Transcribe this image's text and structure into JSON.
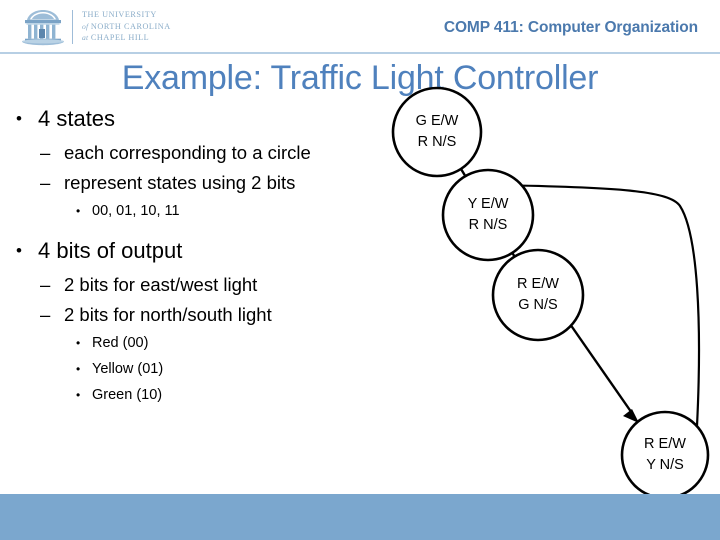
{
  "header": {
    "logo": {
      "mark_name": "unc-old-well-logo",
      "line1": "THE UNIVERSITY",
      "line2_prefix": "of",
      "line2": "NORTH CAROLINA",
      "line3_prefix": "at",
      "line3": "CHAPEL HILL"
    },
    "course_title": "COMP 411: Computer Organization"
  },
  "slide": {
    "title": "Example: Traffic Light Controller"
  },
  "bullets": {
    "group1": {
      "level1": "4 states",
      "level2_a": "each corresponding to a circle",
      "level2_b": "represent states using 2 bits",
      "level3_a": "00, 01, 10, 11"
    },
    "group2": {
      "level1": "4 bits of output",
      "level2_a": "2 bits for east/west light",
      "level2_b": "2 bits for north/south light",
      "level3_a": "Red (00)",
      "level3_b": "Yellow (01)",
      "level3_c": "Green (10)"
    }
  },
  "diagram": {
    "states": [
      {
        "id": "state-1",
        "line1": "G E/W",
        "line2": "R N/S"
      },
      {
        "id": "state-2",
        "line1": "Y E/W",
        "line2": "R N/S"
      },
      {
        "id": "state-3",
        "line1": "R E/W",
        "line2": "G N/S"
      },
      {
        "id": "state-4",
        "line1": "R E/W",
        "line2": "Y N/S"
      }
    ],
    "transitions": [
      {
        "from": "state-1",
        "to": "state-2"
      },
      {
        "from": "state-2",
        "to": "state-3"
      },
      {
        "from": "state-3",
        "to": "state-4"
      },
      {
        "from": "state-4",
        "to": "state-1"
      }
    ]
  },
  "colors": {
    "accent_blue": "#4f81bd",
    "header_blue": "#4b79ad",
    "band_blue": "#7ba7ce",
    "logo_blue": "#8badc9",
    "rule_blue": "#b7cfe4"
  }
}
